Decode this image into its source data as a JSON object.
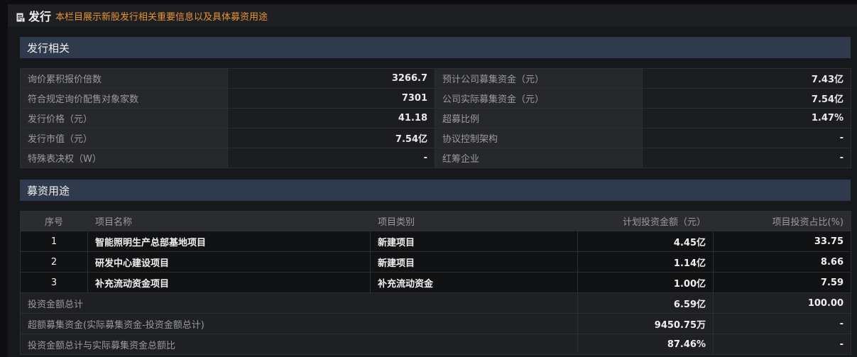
{
  "header": {
    "title": "发行",
    "subtitle": "本栏目展示新股发行相关重要信息以及具体募资用途"
  },
  "issuance": {
    "section_title": "发行相关",
    "rows": [
      {
        "left_label": "询价累积报价倍数",
        "left_value": "3266.7",
        "right_label": "预计公司募集资金（元）",
        "right_value": "7.43亿"
      },
      {
        "left_label": "符合规定询价配售对象家数",
        "left_value": "7301",
        "right_label": "公司实际募集资金（元）",
        "right_value": "7.54亿"
      },
      {
        "left_label": "发行价格（元）",
        "left_value": "41.18",
        "right_label": "超募比例",
        "right_value": "1.47%"
      },
      {
        "left_label": "发行市值（元）",
        "left_value": "7.54亿",
        "right_label": "协议控制架构",
        "right_value": "-"
      },
      {
        "left_label": "特殊表决权（W）",
        "left_value": "-",
        "right_label": "红筹企业",
        "right_value": "-"
      }
    ]
  },
  "fund_use": {
    "section_title": "募资用途",
    "columns": [
      "序号",
      "项目名称",
      "项目类别",
      "计划投资金额（元）",
      "项目投资占比(%)"
    ],
    "projects": [
      {
        "no": "1",
        "name": "智能照明生产总部基地项目",
        "category": "新建项目",
        "amount": "4.45亿",
        "ratio": "33.75"
      },
      {
        "no": "2",
        "name": "研发中心建设项目",
        "category": "新建项目",
        "amount": "1.14亿",
        "ratio": "8.66"
      },
      {
        "no": "3",
        "name": "补充流动资金项目",
        "category": "补充流动资金",
        "amount": "1.00亿",
        "ratio": "7.59"
      }
    ],
    "summary": [
      {
        "label": "投资金额总计",
        "amount": "6.59亿",
        "ratio": "100.00"
      },
      {
        "label": "超额募集资金(实际募集资金-投资金额总计)",
        "amount": "9450.75万",
        "ratio": "-"
      },
      {
        "label": "投资金额总计与实际募集资金总额比",
        "amount": "87.46%",
        "ratio": "-"
      }
    ]
  }
}
